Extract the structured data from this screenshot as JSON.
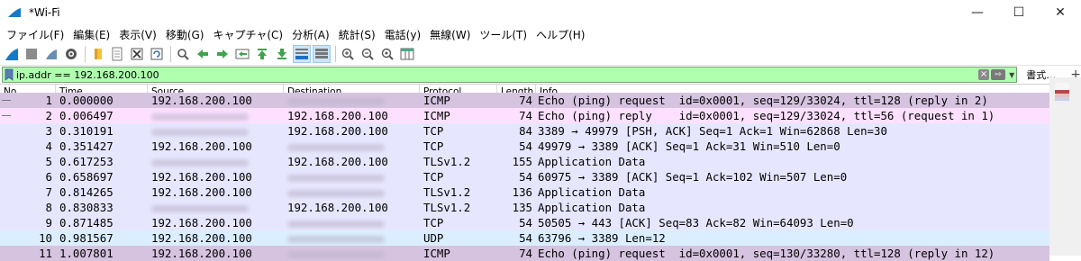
{
  "window": {
    "title": "*Wi-Fi",
    "minimize": "—",
    "maximize": "☐",
    "close": "✕"
  },
  "menu": [
    "ファイル(F)",
    "編集(E)",
    "表示(V)",
    "移動(G)",
    "キャプチャ(C)",
    "分析(A)",
    "統計(S)",
    "電話(y)",
    "無線(W)",
    "ツール(T)",
    "ヘルプ(H)"
  ],
  "filter": {
    "value": "ip.addr == 192.168.200.100",
    "expression_label": "書式…",
    "plus": "+"
  },
  "columns": {
    "no": "No.",
    "time": "Time",
    "source": "Source",
    "destination": "Destination",
    "protocol": "Protocol",
    "length": "Length",
    "info": "Info"
  },
  "colors": {
    "icmp_request": "#d6c3e0",
    "icmp_reply": "#fde0ff",
    "tcp": "#e7e6ff",
    "udp": "#daeeff",
    "filter_ok": "#afffaf"
  },
  "packets": [
    {
      "no": "1",
      "time": "0.000000",
      "source": "192.168.200.100",
      "destination": "",
      "protocol": "ICMP",
      "length": "74",
      "info": "Echo (ping) request  id=0x0001, seq=129/33024, ttl=128 (reply in 2)"
    },
    {
      "no": "2",
      "time": "0.006497",
      "source": "",
      "destination": "192.168.200.100",
      "protocol": "ICMP",
      "length": "74",
      "info": "Echo (ping) reply    id=0x0001, seq=129/33024, ttl=56 (request in 1)"
    },
    {
      "no": "3",
      "time": "0.310191",
      "source": "",
      "destination": "192.168.200.100",
      "protocol": "TCP",
      "length": "84",
      "info": "3389 → 49979 [PSH, ACK] Seq=1 Ack=1 Win=62868 Len=30"
    },
    {
      "no": "4",
      "time": "0.351427",
      "source": "192.168.200.100",
      "destination": "",
      "protocol": "TCP",
      "length": "54",
      "info": "49979 → 3389 [ACK] Seq=1 Ack=31 Win=510 Len=0"
    },
    {
      "no": "5",
      "time": "0.617253",
      "source": "",
      "destination": "192.168.200.100",
      "protocol": "TLSv1.2",
      "length": "155",
      "info": "Application Data"
    },
    {
      "no": "6",
      "time": "0.658697",
      "source": "192.168.200.100",
      "destination": "",
      "protocol": "TCP",
      "length": "54",
      "info": "60975 → 3389 [ACK] Seq=1 Ack=102 Win=507 Len=0"
    },
    {
      "no": "7",
      "time": "0.814265",
      "source": "192.168.200.100",
      "destination": "",
      "protocol": "TLSv1.2",
      "length": "136",
      "info": "Application Data"
    },
    {
      "no": "8",
      "time": "0.830833",
      "source": "",
      "destination": "192.168.200.100",
      "protocol": "TLSv1.2",
      "length": "135",
      "info": "Application Data"
    },
    {
      "no": "9",
      "time": "0.871485",
      "source": "192.168.200.100",
      "destination": "",
      "protocol": "TCP",
      "length": "54",
      "info": "50505 → 443 [ACK] Seq=83 Ack=82 Win=64093 Len=0"
    },
    {
      "no": "10",
      "time": "0.981567",
      "source": "192.168.200.100",
      "destination": "",
      "protocol": "UDP",
      "length": "54",
      "info": "63796 → 3389 Len=12"
    },
    {
      "no": "11",
      "time": "1.007801",
      "source": "192.168.200.100",
      "destination": "",
      "protocol": "ICMP",
      "length": "74",
      "info": "Echo (ping) request  id=0x0001, seq=130/33280, ttl=128 (reply in 12)"
    }
  ]
}
